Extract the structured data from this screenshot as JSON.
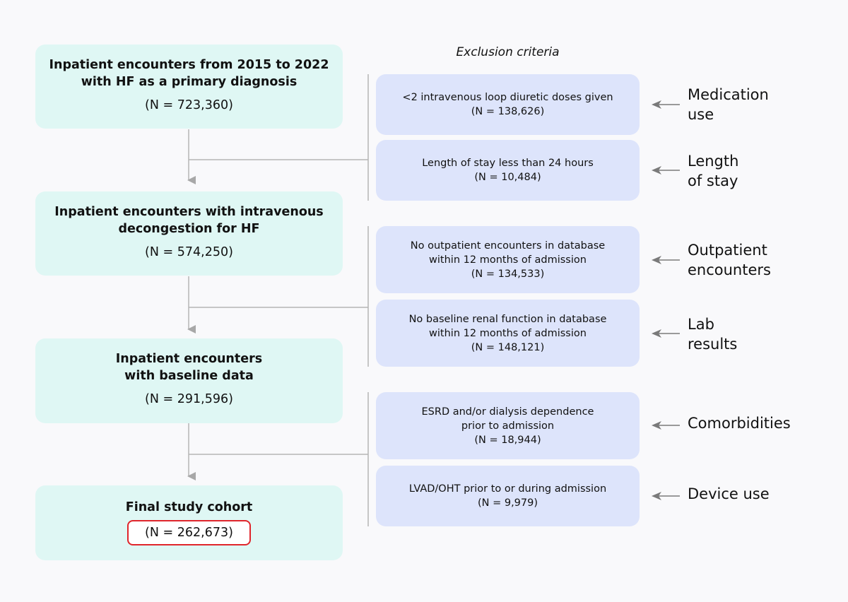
{
  "header": {
    "exclusion_title": "Exclusion criteria"
  },
  "colors": {
    "main_box": "#dff7f4",
    "exclusion_box": "#dde4fb",
    "connector": "#b5b5b5",
    "arrow": "#7a7a7a",
    "highlight": "#e0252b",
    "background": "#f9f9fb"
  },
  "main_steps": [
    {
      "title": "Inpatient encounters from 2015 to 2022\nwith HF as a primary diagnosis",
      "n": "(N = 723,360)"
    },
    {
      "title": "Inpatient encounters with intravenous\ndecongestion for HF",
      "n": "(N = 574,250)"
    },
    {
      "title": "Inpatient encounters\nwith baseline data",
      "n": "(N = 291,596)"
    },
    {
      "title": "Final study cohort",
      "n": "(N = 262,673)"
    }
  ],
  "exclusions": [
    {
      "text": "<2 intravenous loop diuretic doses given",
      "n": "(N = 138,626)",
      "category": "Medication\nuse"
    },
    {
      "text": "Length of stay less than 24 hours",
      "n": "(N = 10,484)",
      "category": "Length\nof stay"
    },
    {
      "text": "No outpatient encounters in database\nwithin 12 months of admission",
      "n": "(N = 134,533)",
      "category": "Outpatient\nencounters"
    },
    {
      "text": "No baseline renal function in database\nwithin 12 months of admission",
      "n": "(N = 148,121)",
      "category": "Lab\nresults"
    },
    {
      "text": "ESRD and/or dialysis dependence\nprior to admission",
      "n": "(N = 18,944)",
      "category": "Comorbidities"
    },
    {
      "text": "LVAD/OHT prior to or during admission",
      "n": "(N = 9,979)",
      "category": "Device use"
    }
  ]
}
